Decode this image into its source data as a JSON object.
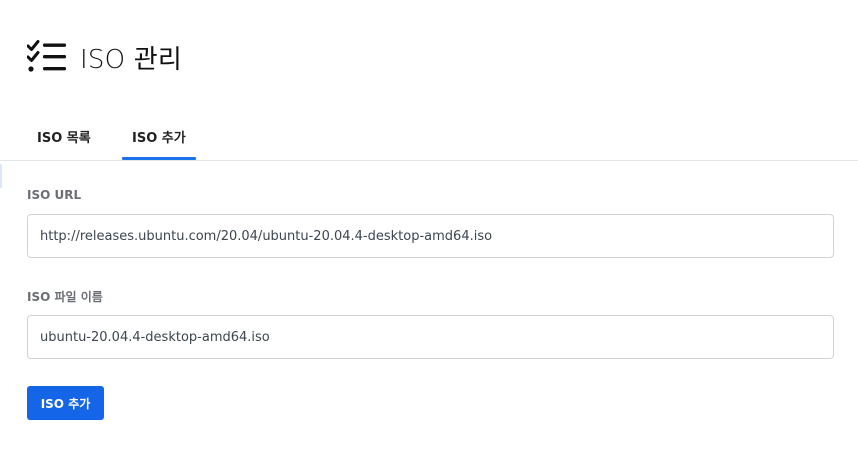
{
  "header": {
    "title": "ISO 관리",
    "icon": "checklist-icon"
  },
  "tabs": [
    {
      "label": "ISO 목록",
      "active": false
    },
    {
      "label": "ISO 추가",
      "active": true
    }
  ],
  "form": {
    "url_label": "ISO URL",
    "url_value": "http://releases.ubuntu.com/20.04/ubuntu-20.04.4-desktop-amd64.iso",
    "name_label": "ISO 파일 이름",
    "name_value": "ubuntu-20.04.4-desktop-amd64.iso",
    "submit_label": "ISO 추가"
  },
  "colors": {
    "accent": "#1a73e8",
    "button": "#1565e8"
  }
}
